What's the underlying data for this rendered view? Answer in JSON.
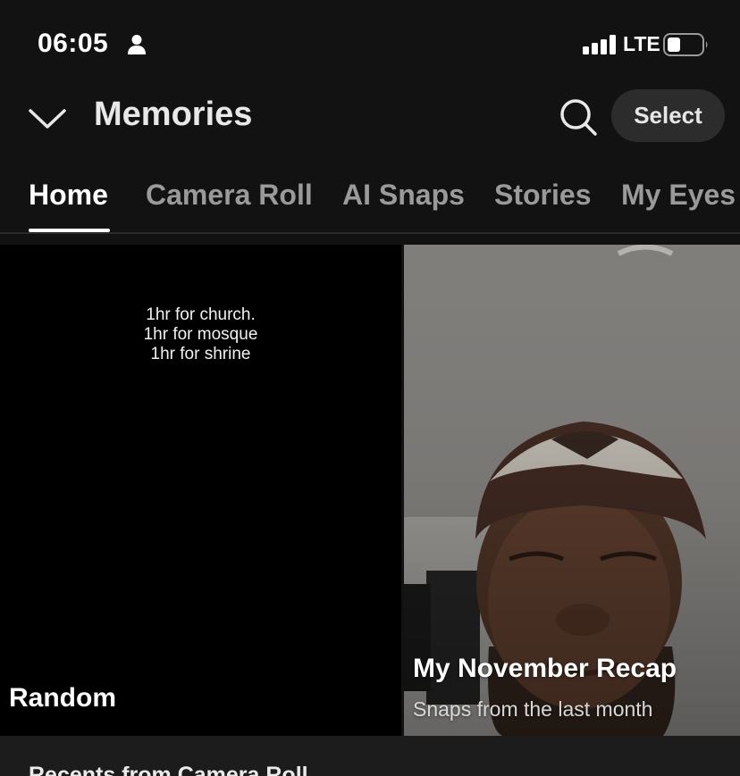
{
  "status_bar": {
    "time": "06:05",
    "network": "LTE",
    "icons": [
      "person-icon",
      "signal-icon",
      "battery-icon"
    ]
  },
  "header": {
    "title": "Memories",
    "select_label": "Select",
    "icons": [
      "chevron-down-icon",
      "search-icon"
    ]
  },
  "tabs": [
    {
      "label": "Home",
      "active": true
    },
    {
      "label": "Camera Roll",
      "active": false
    },
    {
      "label": "AI Snaps",
      "active": false
    },
    {
      "label": "Stories",
      "active": false
    },
    {
      "label": "My Eyes Only",
      "active": false
    }
  ],
  "tiles": {
    "random": {
      "label": "Random",
      "snap_text": [
        "1hr for church.",
        "1hr for mosque",
        "1hr for shrine"
      ]
    },
    "recap": {
      "title": "My November Recap",
      "subtitle": "Snaps from the last month"
    }
  },
  "recents": {
    "title": "Recents from Camera Roll"
  },
  "colors": {
    "background": "#121212",
    "active_tab": "#ffffff",
    "inactive_tab": "#9a9a9a",
    "select_button_bg": "#2c2c2c"
  }
}
